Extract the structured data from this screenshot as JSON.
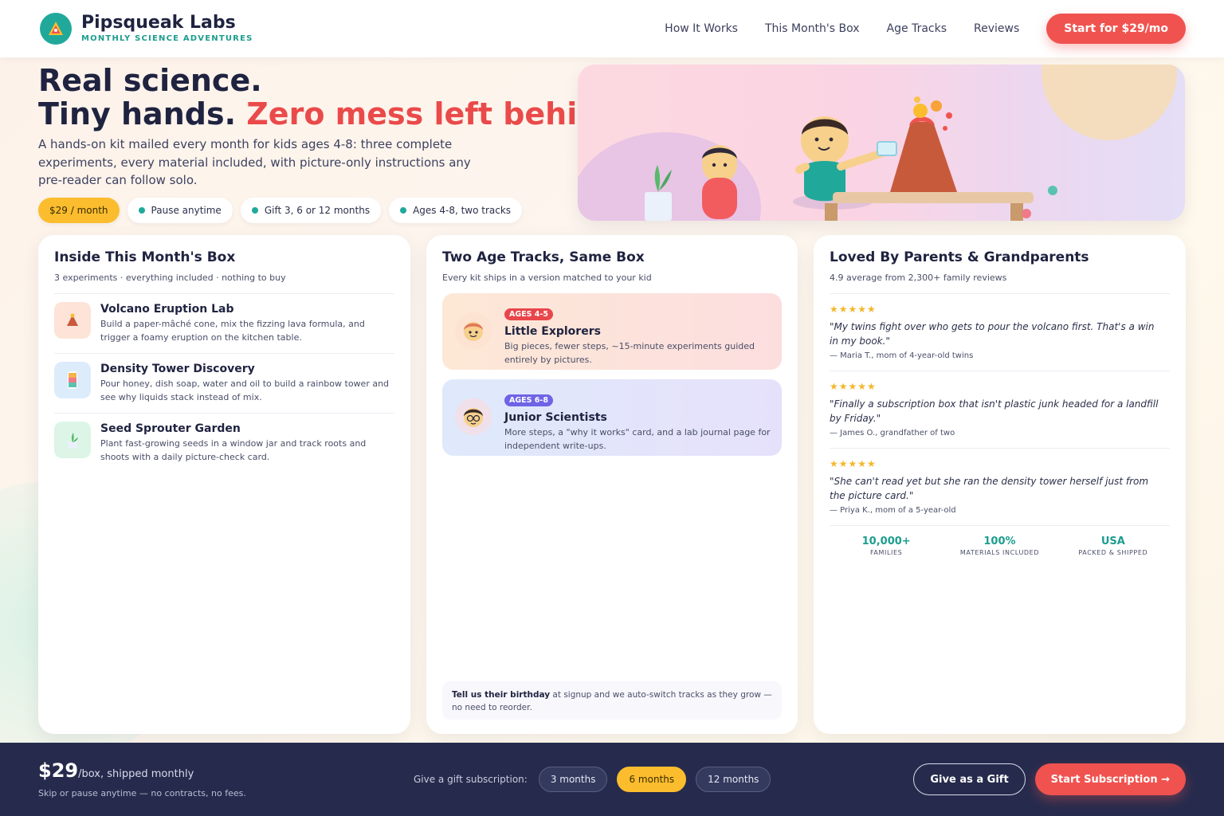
{
  "nav": {
    "brand_name": "Pipsqueak Labs",
    "brand_tagline": "MONTHLY SCIENCE ADVENTURES",
    "links": [
      "How It Works",
      "This Month's Box",
      "Age Tracks",
      "Reviews"
    ],
    "cta": "Start for $29/mo"
  },
  "hero": {
    "title_line1": "Real science.",
    "title_line2_plain": "Tiny hands.",
    "title_line2_accent": "Zero mess left behind.",
    "subtitle": "A hands-on kit mailed every month for kids ages 4-8: three complete experiments, every material included, with picture-only instructions any pre-reader can follow solo.",
    "pills": {
      "price": "$29 / month",
      "pause": "Pause anytime",
      "gift": "Gift 3, 6 or 12 months",
      "ages": "Ages 4-8, two tracks"
    }
  },
  "box": {
    "title": "Inside This Month's Box",
    "subtitle": "3 experiments · everything included · nothing to buy",
    "experiments": [
      {
        "name": "Volcano Eruption Lab",
        "desc": "Build a paper-mâché cone, mix the fizzing lava formula, and trigger a foamy eruption on the kitchen table.",
        "icon": "volcano-icon"
      },
      {
        "name": "Density Tower Discovery",
        "desc": "Pour honey, dish soap, water and oil to build a rainbow tower and see why liquids stack instead of mix.",
        "icon": "density-tower-icon"
      },
      {
        "name": "Seed Sprouter Garden",
        "desc": "Plant fast-growing seeds in a window jar and track roots and shoots with a daily picture-check card.",
        "icon": "sprout-icon"
      }
    ]
  },
  "tracks": {
    "title": "Two Age Tracks, Same Box",
    "subtitle": "Every kit ships in a version matched to your kid",
    "items": [
      {
        "badge": "AGES 4-5",
        "name": "Little Explorers",
        "desc": "Big pieces, fewer steps, ~15-minute experiments guided entirely by pictures.",
        "badge_color": "#e8464b"
      },
      {
        "badge": "AGES 6-8",
        "name": "Junior Scientists",
        "desc": "More steps, a \"why it works\" card, and a lab journal page for independent write-ups.",
        "badge_color": "#6f63e6"
      }
    ],
    "note_bold": "Tell us their birthday",
    "note_rest": " at signup and we auto-switch tracks as they grow — no need to reorder."
  },
  "reviews": {
    "title": "Loved By Parents & Grandparents",
    "subtitle": "4.9 average from 2,300+ family reviews",
    "items": [
      {
        "stars": "★★★★★",
        "quote": "\"My twins fight over who gets to pour the volcano first. That's a win in my book.\"",
        "author": "— Maria T., mom of 4-year-old twins"
      },
      {
        "stars": "★★★★★",
        "quote": "\"Finally a subscription box that isn't plastic junk headed for a landfill by Friday.\"",
        "author": "— James O., grandfather of two"
      },
      {
        "stars": "★★★★★",
        "quote": "\"She can't read yet but she ran the density tower herself just from the picture card.\"",
        "author": "— Priya K., mom of a 5-year-old"
      }
    ],
    "stats": [
      {
        "value": "10,000+",
        "label": "FAMILIES"
      },
      {
        "value": "100%",
        "label": "MATERIALS INCLUDED"
      },
      {
        "value": "USA",
        "label": "PACKED & SHIPPED"
      }
    ]
  },
  "bar": {
    "price": "$29",
    "unit": "/box, shipped monthly",
    "note": "Skip or pause anytime — no contracts, no fees.",
    "gift_label": "Give a gift subscription:",
    "gift_options": [
      "3 months",
      "6 months",
      "12 months"
    ],
    "gift_selected": "6 months",
    "gift_button": "Give as a Gift",
    "start_button": "Start Subscription →"
  },
  "colors": {
    "accent_red": "#f0534f",
    "teal": "#20a99b",
    "yellow": "#fbbd2e",
    "navy": "#262b4d"
  }
}
